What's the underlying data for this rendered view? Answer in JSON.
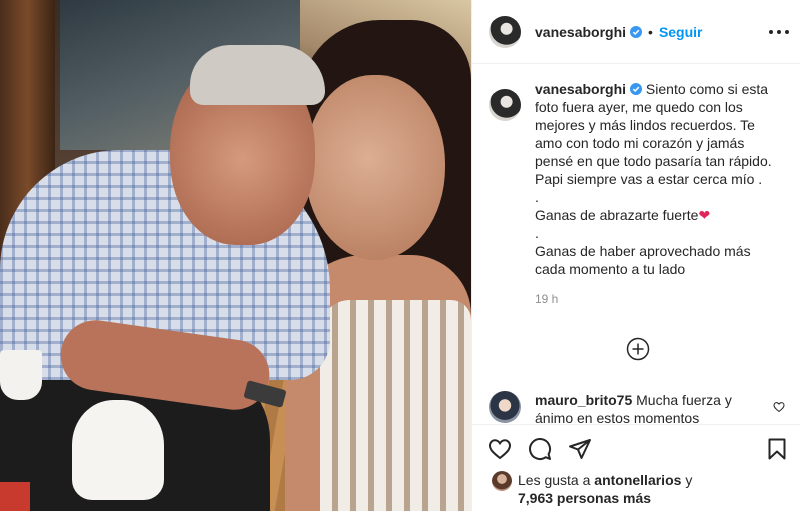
{
  "post": {
    "username": "vanesaborghi",
    "separator": "•",
    "follow_label": "Seguir",
    "caption_lines": [
      "Siento como si esta foto fuera ayer, me quedo con los mejores y más lindos recuerdos. Te amo con todo mi corazón y jamás pensé en que todo pasaría tan rápido. Papi siempre vas a estar cerca mío .",
      ".",
      "Ganas de abrazarte fuerte",
      ".",
      "Ganas de haber aprovechado más cada momento a tu lado"
    ],
    "heart_emoji": "❤",
    "time": "19 h"
  },
  "comment": {
    "username": "mauro_brito75",
    "text": "Mucha fuerza y ánimo en estos momentos"
  },
  "likes": {
    "prefix": "Les gusta a",
    "user": "antonellarios",
    "suffix": "y",
    "count": "7,963 personas más"
  },
  "colors": {
    "follow": "#0095f6",
    "verified": "#3897f0",
    "text": "#262626",
    "muted": "#8e8e8e"
  },
  "icons": [
    "more-options-icon",
    "verified-badge-icon",
    "load-more-comments-icon",
    "like-icon",
    "comment-icon",
    "share-icon",
    "save-icon",
    "comment-like-icon"
  ]
}
